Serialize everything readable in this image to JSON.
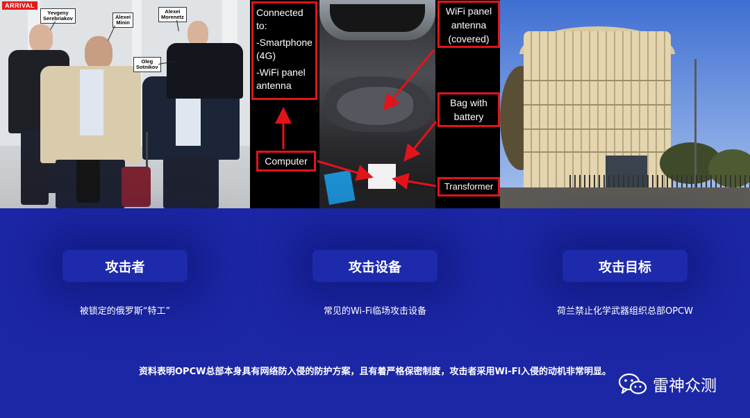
{
  "photos": {
    "cctv": {
      "stamp": "ARRIVAL",
      "tags": [
        {
          "line1": "Yevgeny",
          "line2": "Serebriakov"
        },
        {
          "line1": "Alexei",
          "line2": "Minin"
        },
        {
          "line1": "Alexei",
          "line2": "Morenetz"
        },
        {
          "line1": "Oleg",
          "line2": "Sotnikov"
        }
      ]
    },
    "equipment": {
      "connected_title": "Connected to:",
      "connected_item1": "-Smartphone (4G)",
      "connected_item2": "-WiFi panel antenna",
      "wifi_panel": "WiFi panel antenna (covered)",
      "bag": "Bag with battery",
      "computer": "Computer",
      "transformer": "Transformer"
    }
  },
  "columns": [
    {
      "title": "攻击者",
      "caption": "被锁定的俄罗斯“特工”"
    },
    {
      "title": "攻击设备",
      "caption": "常见的Wi-Fi临场攻击设备"
    },
    {
      "title": "攻击目标",
      "caption": "荷兰禁止化学武器组织总部OPCW"
    }
  ],
  "summary": "资料表明OPCW总部本身具有网络防入侵的防护方案，且有着严格保密制度，攻击者采用Wi-Fi入侵的动机非常明显。",
  "brand": {
    "name": "雷神众测",
    "icon": "wechat-icon"
  },
  "colors": {
    "background": "#1c27a6",
    "callout_border": "#e3131b",
    "stamp": "#e41b17"
  }
}
